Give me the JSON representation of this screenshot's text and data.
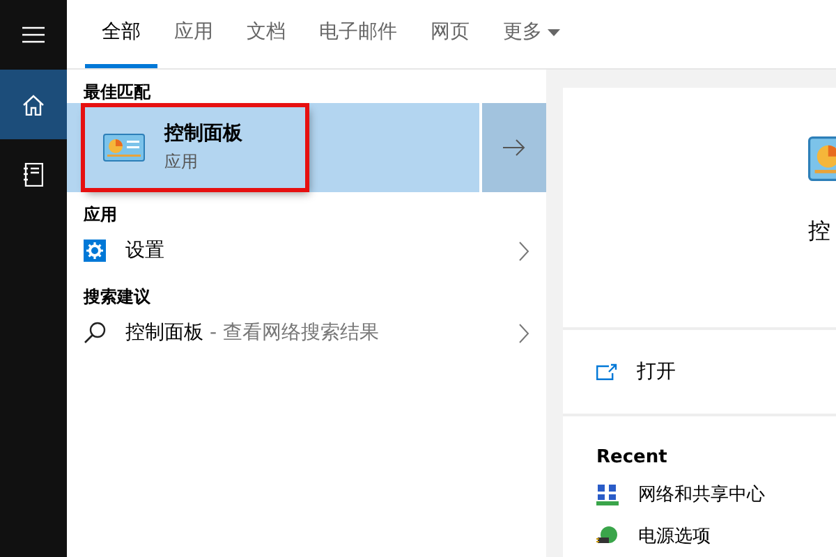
{
  "sidebar": {
    "items": [
      {
        "kind": "menu",
        "selected": false
      },
      {
        "kind": "home",
        "selected": true
      },
      {
        "kind": "notebook",
        "selected": false
      }
    ]
  },
  "tabs": [
    {
      "label": "全部",
      "selected": true
    },
    {
      "label": "应用",
      "selected": false
    },
    {
      "label": "文档",
      "selected": false
    },
    {
      "label": "电子邮件",
      "selected": false
    },
    {
      "label": "网页",
      "selected": false
    },
    {
      "label": "更多",
      "selected": false,
      "dropdown": true
    }
  ],
  "best_match": {
    "heading": "最佳匹配",
    "title": "控制面板",
    "subtitle": "应用",
    "highlighted": true
  },
  "apps": {
    "heading": "应用",
    "items": [
      {
        "label": "设置"
      }
    ]
  },
  "suggestions": {
    "heading": "搜索建议",
    "items": [
      {
        "query": "控制面板",
        "hint": "- 查看网络搜索结果"
      }
    ]
  },
  "preview": {
    "title": "控",
    "actions": [
      {
        "label": "打开"
      }
    ],
    "recent_heading": "Recent",
    "recent": [
      {
        "label": "网络和共享中心",
        "kind": "network"
      },
      {
        "label": "电源选项",
        "kind": "power"
      }
    ]
  }
}
